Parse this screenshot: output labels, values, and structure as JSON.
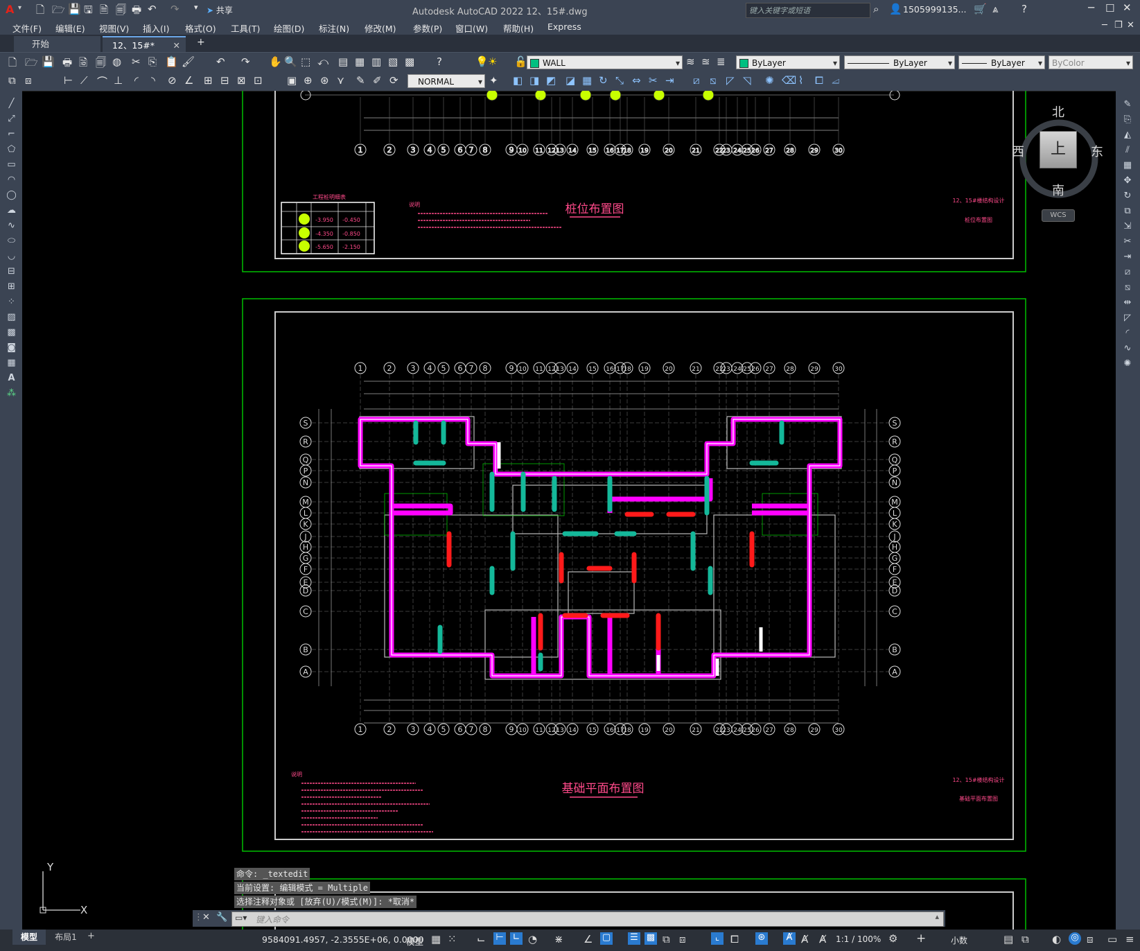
{
  "window": {
    "title": "Autodesk AutoCAD 2022    12、15#.dwg",
    "search_placeholder": "键入关键字或短语",
    "user": "1505999135...",
    "share_label": "共享"
  },
  "menu": [
    "文件(F)",
    "编辑(E)",
    "视图(V)",
    "插入(I)",
    "格式(O)",
    "工具(T)",
    "绘图(D)",
    "标注(N)",
    "修改(M)",
    "参数(P)",
    "窗口(W)",
    "帮助(H)",
    "Express"
  ],
  "tabs": [
    {
      "label": "开始"
    },
    {
      "label": "12、15#*"
    }
  ],
  "layers": {
    "current_layer": "WALL",
    "color": "ByLayer",
    "linetype": "ByLayer",
    "lineweight": "ByLayer",
    "plotstyle": "ByColor",
    "style": "NORMAL",
    "layer_swatch": "#00c080"
  },
  "viewcube": {
    "north": "北",
    "south": "南",
    "east": "东",
    "west": "西",
    "face": "上",
    "wcs": "WCS"
  },
  "ucs": {
    "y": "Y",
    "x": "X"
  },
  "drawing": {
    "sheet1_title": "桩位布置图",
    "sheet2_title": "基础平面布置图",
    "table_title": "工程桩明细表",
    "values": [
      "-3.950",
      "-0.450",
      "-4.350",
      "-0.850",
      "-5.650",
      "-2.150"
    ],
    "notes_header": "说明",
    "project": "12、15#楼结构设计",
    "sheet1_sub": "桩位布置图",
    "sheet2_sub": "基础平面布置图",
    "col_labels": [
      "1",
      "2",
      "3",
      "4",
      "5",
      "6",
      "7",
      "8",
      "9",
      "10",
      "11",
      "12",
      "13",
      "14",
      "15",
      "16",
      "17",
      "18",
      "19",
      "20",
      "21",
      "22",
      "23",
      "24",
      "25",
      "26",
      "27",
      "28",
      "29",
      "30"
    ],
    "row_labels": [
      "S",
      "R",
      "Q",
      "P",
      "N",
      "M",
      "L",
      "K",
      "J",
      "H",
      "G",
      "F",
      "E",
      "D",
      "C",
      "B",
      "A"
    ]
  },
  "command": {
    "line1": "命令: _textedit",
    "line2": "当前设置: 编辑模式 = Multiple",
    "line3": "选择注释对象或 [放弃(U)/模式(M)]: *取消*",
    "placeholder": "键入命令"
  },
  "status": {
    "model_tab": "模型",
    "layout_tab": "布局1",
    "coords": "9584091.4957, -2.3555E+06, 0.0000",
    "space": "模型",
    "scale": "1:1 / 100%",
    "units": "小数"
  }
}
